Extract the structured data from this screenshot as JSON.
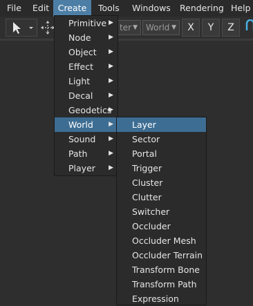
{
  "menubar": {
    "items": [
      {
        "label": "File"
      },
      {
        "label": "Edit"
      },
      {
        "label": "Create",
        "active": true
      },
      {
        "label": "Tools"
      },
      {
        "label": "Windows"
      },
      {
        "label": "Rendering"
      },
      {
        "label": "Help"
      }
    ]
  },
  "toolbar": {
    "filter_combo_value": "ter",
    "world_combo_value": "World",
    "axis_x": "X",
    "axis_y": "Y",
    "axis_z": "Z"
  },
  "create_menu": {
    "items": [
      {
        "label": "Primitive",
        "arrow": "▶"
      },
      {
        "label": "Node",
        "arrow": "▶"
      },
      {
        "label": "Object",
        "arrow": "▶"
      },
      {
        "label": "Effect",
        "arrow": "▶"
      },
      {
        "label": "Light",
        "arrow": "▶"
      },
      {
        "label": "Decal",
        "arrow": "▶"
      },
      {
        "label": "Geodetics",
        "arrow": "▶"
      },
      {
        "label": "World",
        "arrow": "▶",
        "highlighted": true
      },
      {
        "label": "Sound",
        "arrow": "▶"
      },
      {
        "label": "Path",
        "arrow": "▶"
      },
      {
        "label": "Player",
        "arrow": "▶"
      }
    ]
  },
  "world_submenu": {
    "items": [
      {
        "label": "Layer",
        "highlighted": true
      },
      {
        "label": "Sector"
      },
      {
        "label": "Portal"
      },
      {
        "label": "Trigger"
      },
      {
        "label": "Cluster"
      },
      {
        "label": "Clutter"
      },
      {
        "label": "Switcher"
      },
      {
        "label": "Occluder"
      },
      {
        "label": "Occluder Mesh"
      },
      {
        "label": "Occluder Terrain"
      },
      {
        "label": "Transform Bone"
      },
      {
        "label": "Transform Path"
      },
      {
        "label": "Expression"
      }
    ]
  },
  "colors": {
    "menu_bg": "#2b2b2b",
    "highlight": "#3e6d93",
    "active_menubar": "#4d7fa6"
  }
}
